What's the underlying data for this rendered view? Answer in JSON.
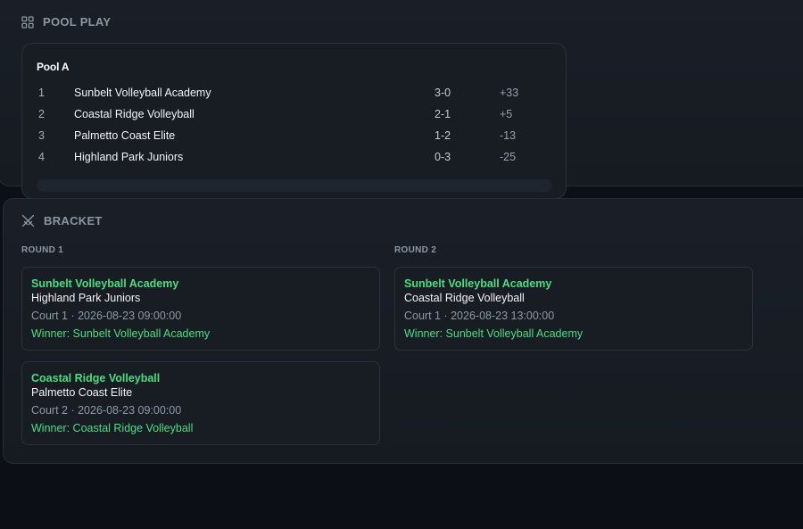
{
  "pool_play": {
    "header": "POOL PLAY",
    "icon": "grid-icon",
    "pools": [
      {
        "name": "Pool A",
        "standings": [
          {
            "rank": "1",
            "team": "Sunbelt Volleyball Academy",
            "record": "3-0",
            "diff": "+33"
          },
          {
            "rank": "2",
            "team": "Coastal Ridge Volleyball",
            "record": "2-1",
            "diff": "+5"
          },
          {
            "rank": "3",
            "team": "Palmetto Coast Elite",
            "record": "1-2",
            "diff": "-13"
          },
          {
            "rank": "4",
            "team": "Highland Park Juniors",
            "record": "0-3",
            "diff": "-25"
          }
        ]
      }
    ]
  },
  "bracket": {
    "header": "BRACKET",
    "icon": "crossed-swords-icon",
    "rounds": [
      {
        "label": "ROUND 1",
        "matches": [
          {
            "team1": "Sunbelt Volleyball Academy",
            "team2": "Highland Park Juniors",
            "meta": "Court 1 · 2026-08-23 09:00:00",
            "winner": "Winner: Sunbelt Volleyball Academy"
          },
          {
            "team1": "Coastal Ridge Volleyball",
            "team2": "Palmetto Coast Elite",
            "meta": "Court 2 · 2026-08-23 09:00:00",
            "winner": "Winner: Coastal Ridge Volleyball"
          }
        ]
      },
      {
        "label": "ROUND 2",
        "matches": [
          {
            "team1": "Sunbelt Volleyball Academy",
            "team2": "Coastal Ridge Volleyball",
            "meta": "Court 1 · 2026-08-23 13:00:00",
            "winner": "Winner: Sunbelt Volleyball Academy"
          }
        ]
      }
    ]
  },
  "colors": {
    "accent_green": "#4ade80",
    "background": "#0c1016",
    "panel": "#181d24",
    "muted_text": "#8d96a3"
  }
}
